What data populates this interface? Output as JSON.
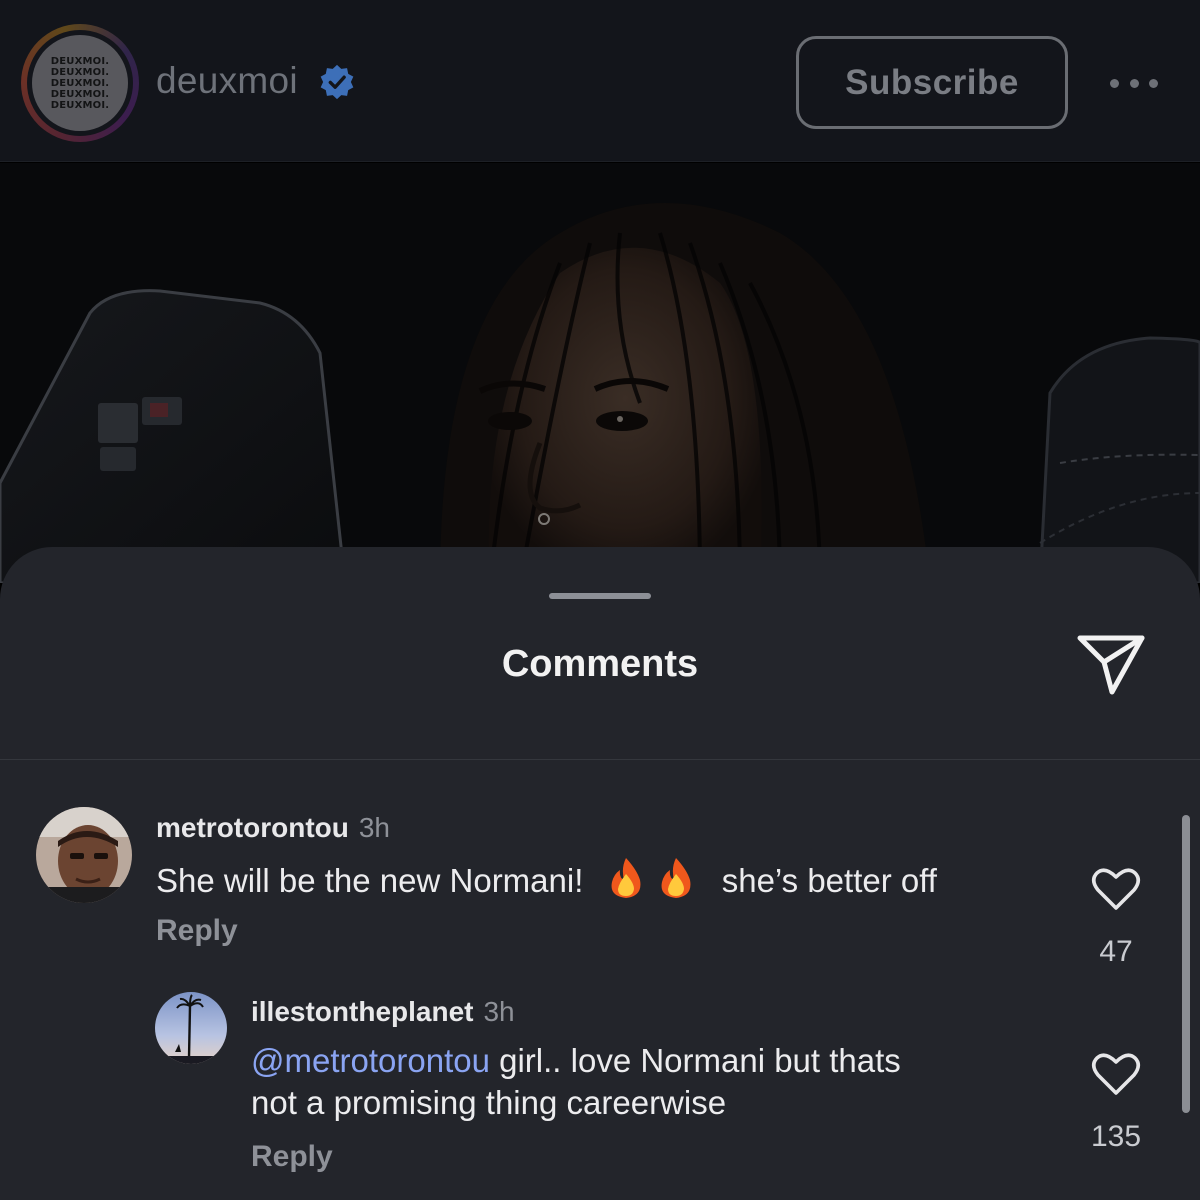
{
  "header": {
    "avatar_text": [
      "DEUXMOI.",
      "DEUXMOI.",
      "DEUXMOI.",
      "DEUXMOI.",
      "DEUXMOI."
    ],
    "account_name": "deuxmoi",
    "subscribe_label": "Subscribe"
  },
  "sheet": {
    "title": "Comments"
  },
  "comments": [
    {
      "username": "metrotorontou",
      "time": "3h",
      "text_before": "She will be the new Normani!",
      "text_after": "she’s better off",
      "emoji": [
        "fire",
        "fire"
      ],
      "reply_label": "Reply",
      "likes": "47"
    },
    {
      "username": "illestontheplanet",
      "time": "3h",
      "mention": "@metrotorontou",
      "text_line1": " girl.. love Normani but thats",
      "text_line2": "not a promising thing careerwise",
      "reply_label": "Reply",
      "likes": "135"
    }
  ],
  "colors": {
    "sheet_bg": "#23252b",
    "mention": "#8aa4f2",
    "verified": "#3d6fb8"
  },
  "icons": [
    "verified-icon",
    "more-icon",
    "share-icon",
    "heart-icon",
    "fire-emoji"
  ]
}
